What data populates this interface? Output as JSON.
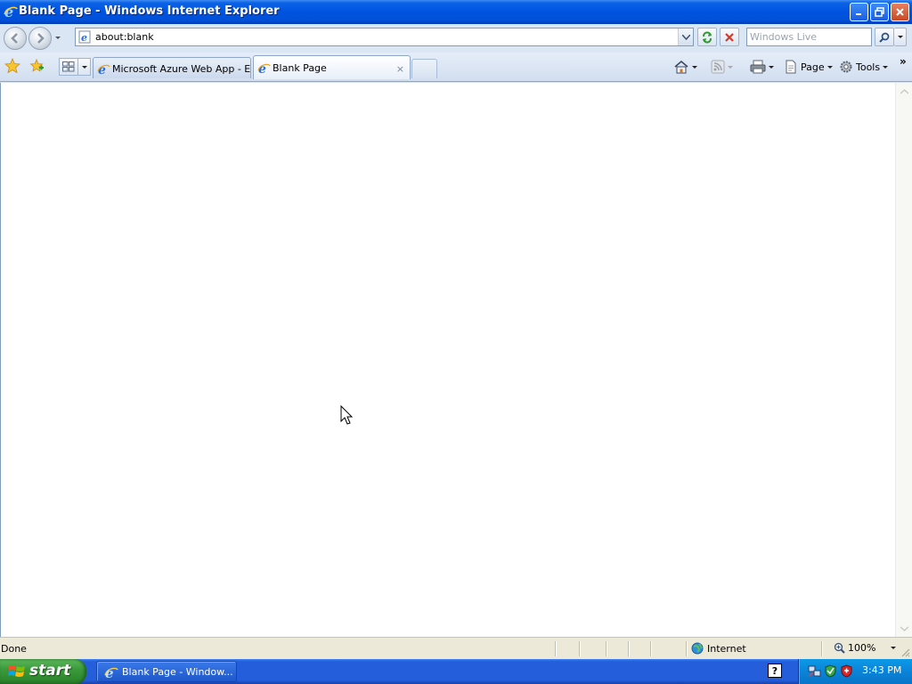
{
  "window": {
    "title": "Blank Page - Windows Internet Explorer"
  },
  "toolbar": {
    "address": "about:blank",
    "search_placeholder": "Windows Live"
  },
  "tabs": [
    {
      "label": "Microsoft Azure Web App - E...",
      "active": false
    },
    {
      "label": "Blank Page",
      "active": true,
      "close": "×"
    }
  ],
  "commandbar": {
    "page_label": "Page",
    "tools_label": "Tools",
    "chevron": "»"
  },
  "statusbar": {
    "status": "Done",
    "zone": "Internet",
    "zoom": "100%"
  },
  "taskbar": {
    "start_label": "start",
    "items": [
      {
        "label": "Blank Page - Window..."
      }
    ],
    "help": "?",
    "clock": "3:43 PM"
  },
  "colors": {
    "titlebar": "#0053e0",
    "taskbar": "#245edb",
    "start": "#3c9a3c",
    "tray": "#0a84d8"
  }
}
